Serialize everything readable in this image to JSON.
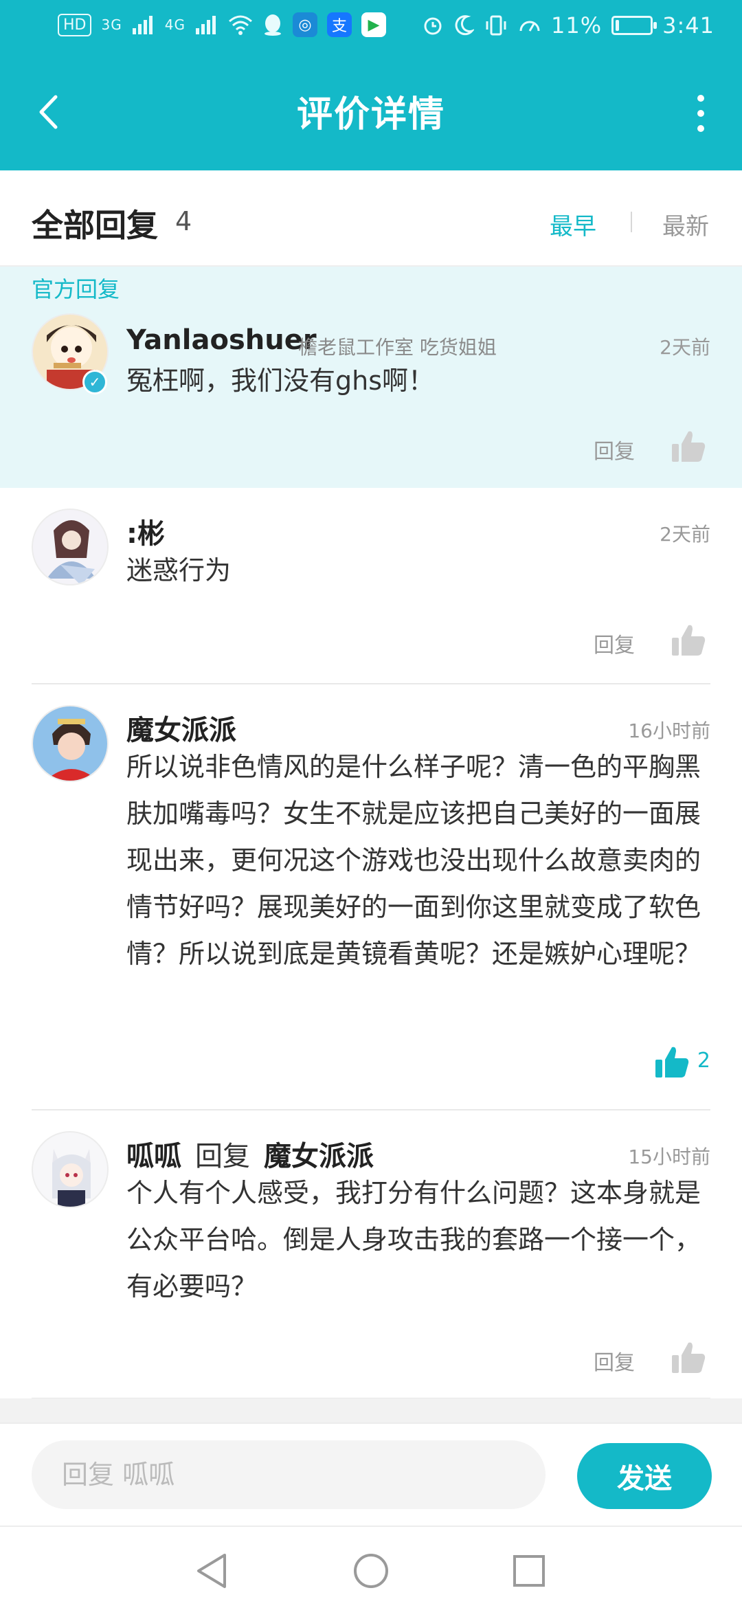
{
  "status_bar": {
    "left_chip": "HD",
    "network_1": "3G",
    "network_2": "4G",
    "battery": "11%",
    "battery_level": 0.11,
    "time": "3:41"
  },
  "app_bar": {
    "title": "评价详情"
  },
  "list_header": {
    "title": "全部回复",
    "count": "4",
    "sort_earliest": "最早",
    "sort_latest": "最新"
  },
  "official_tag": "官方回复",
  "comments": [
    {
      "name": "Yanlaoshuer",
      "sub": "檐老鼠工作室 吃货姐姐",
      "time": "2天前",
      "body": "冤枉啊，我们没有ghs啊！",
      "reply_label": "回复",
      "verified": true
    },
    {
      "name": ":彬",
      "time": "2天前",
      "body": "迷惑行为",
      "reply_label": "回复"
    },
    {
      "name": "魔女派派",
      "time": "16小时前",
      "body": "所以说非色情风的是什么样子呢？清一色的平胸黑肤加嘴毒吗？女生不就是应该把自己美好的一面展现出来，更何况这个游戏也没出现什么故意卖肉的情节好吗？展现美好的一面到你这里就变成了软色情？所以说到底是黄镜看黄呢？还是嫉妒心理呢？",
      "likes": "2"
    },
    {
      "name": "呱呱",
      "reply_word": "回复",
      "reply_to": "魔女派派",
      "time": "15小时前",
      "body": "个人有个人感受，我打分有什么问题？这本身就是公众平台哈。倒是人身攻击我的套路一个接一个，有必要吗？",
      "reply_label": "回复"
    }
  ],
  "input": {
    "placeholder": "回复 呱呱",
    "send_label": "发送"
  },
  "colors": {
    "accent": "#14b9c8",
    "official_bg": "#e6f7f9"
  }
}
